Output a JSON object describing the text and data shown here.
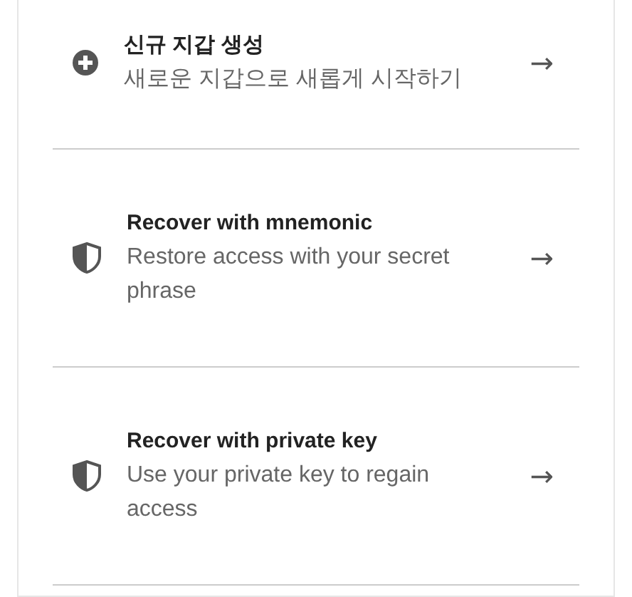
{
  "options": [
    {
      "kind": "plus",
      "title": "신규 지갑 생성",
      "description": "새로운 지갑으로 새롭게 시작하기",
      "arrow": "→"
    },
    {
      "kind": "shield",
      "title": "Recover with mnemonic",
      "description": "Restore access with your secret phrase",
      "arrow": "→"
    },
    {
      "kind": "shield",
      "title": "Recover with private key",
      "description": "Use your private key to regain access",
      "arrow": "→"
    }
  ]
}
